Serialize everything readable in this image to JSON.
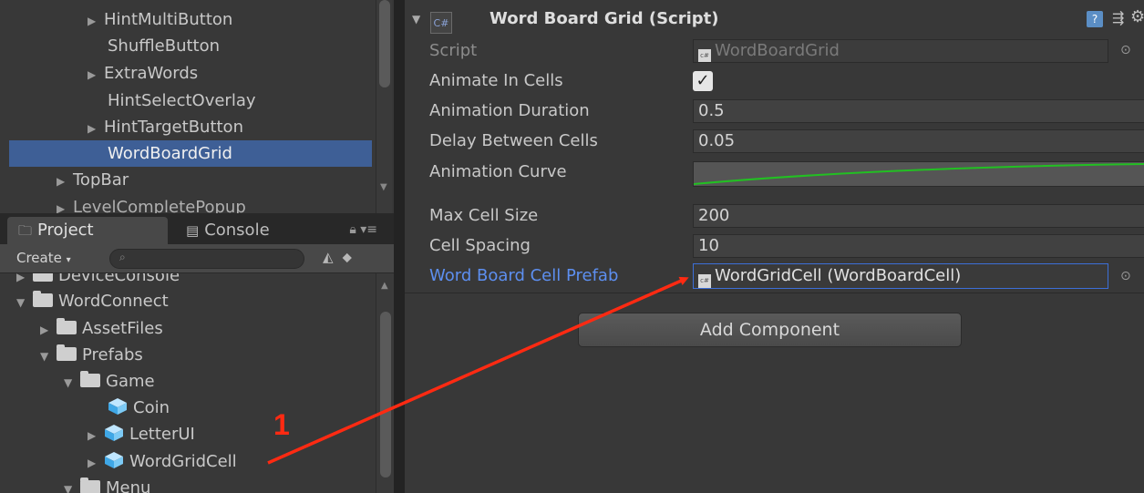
{
  "hierarchy": {
    "items": [
      {
        "label": "HintMultiButton",
        "expandable": true
      },
      {
        "label": "ShuffleButton",
        "expandable": false
      },
      {
        "label": "ExtraWords",
        "expandable": true
      },
      {
        "label": "HintSelectOverlay",
        "expandable": false
      },
      {
        "label": "HintTargetButton",
        "expandable": true
      },
      {
        "label": "WordBoardGrid",
        "expandable": false,
        "selected": true
      },
      {
        "label": "TopBar",
        "expandable": true
      },
      {
        "label": "LevelCompletePopup",
        "expandable": true
      }
    ]
  },
  "project": {
    "tabs": {
      "project": "Project",
      "console": "Console"
    },
    "create_label": "Create",
    "tree": [
      {
        "label": "DeviceConsole",
        "type": "folder"
      },
      {
        "label": "WordConnect",
        "type": "folder"
      },
      {
        "label": "AssetFiles",
        "type": "folder"
      },
      {
        "label": "Prefabs",
        "type": "folder"
      },
      {
        "label": "Game",
        "type": "folder"
      },
      {
        "label": "Coin",
        "type": "prefab"
      },
      {
        "label": "LetterUI",
        "type": "prefab"
      },
      {
        "label": "WordGridCell",
        "type": "prefab"
      },
      {
        "label": "Menu",
        "type": "folder"
      }
    ]
  },
  "inspector": {
    "component_title": "Word Board Grid (Script)",
    "cs_label": "C#",
    "help_label": "?",
    "fields": {
      "script": {
        "label": "Script",
        "value": "WordBoardGrid"
      },
      "animate_in_cells": {
        "label": "Animate In Cells",
        "checked": true
      },
      "animation_duration": {
        "label": "Animation Duration",
        "value": "0.5"
      },
      "delay_between_cells": {
        "label": "Delay Between Cells",
        "value": "0.05"
      },
      "animation_curve": {
        "label": "Animation Curve"
      },
      "max_cell_size": {
        "label": "Max Cell Size",
        "value": "200"
      },
      "cell_spacing": {
        "label": "Cell Spacing",
        "value": "10"
      },
      "word_board_cell_prefab": {
        "label": "Word Board Cell Prefab",
        "value": "WordGridCell (WordBoardCell)"
      }
    },
    "add_component_label": "Add Component"
  },
  "annotation": {
    "number": "1",
    "color": "#ff2a12"
  },
  "colors": {
    "selection": "#3e5f96",
    "link_label": "#5d8ff0",
    "curve": "#22c022",
    "field_highlight": "#3c6fd8"
  }
}
